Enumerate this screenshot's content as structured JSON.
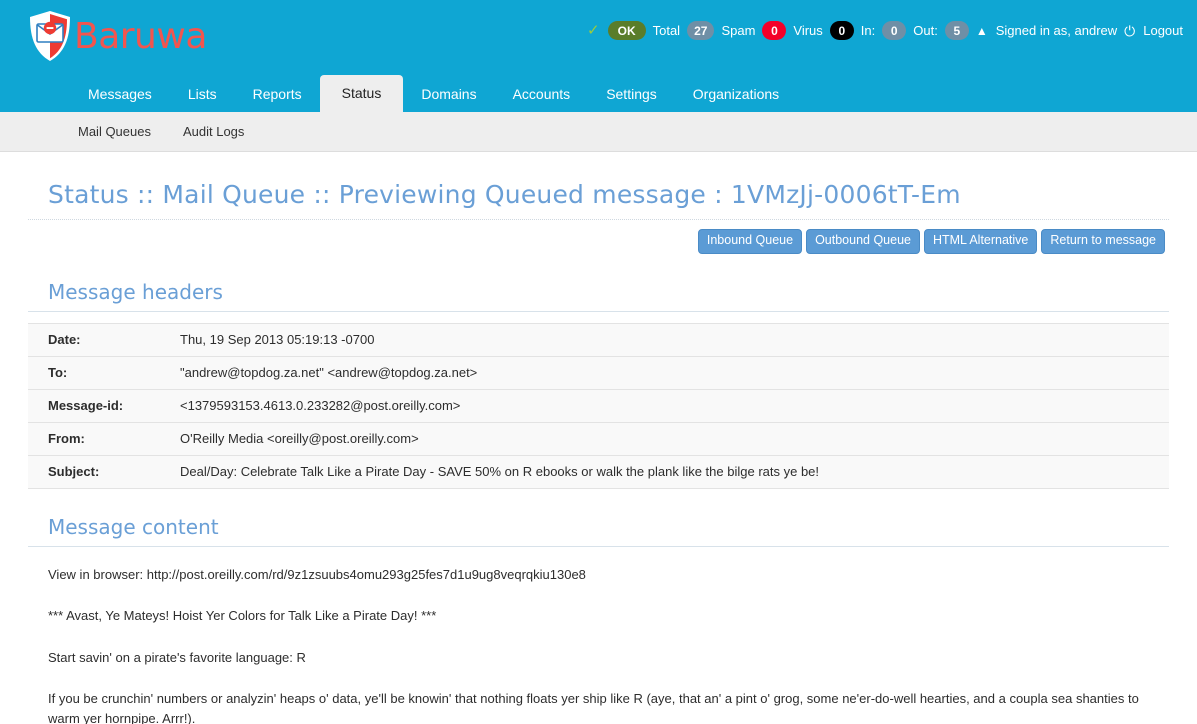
{
  "brand": {
    "name": "Baruwa",
    "logo_icon": "shield-envelope-logo",
    "color": "#f2554e",
    "header_bg": "#0fa6d3"
  },
  "statusbar": {
    "check_icon": "check-icon",
    "ok_label": "OK",
    "total_label": "Total",
    "total_value": "27",
    "spam_label": "Spam",
    "spam_value": "0",
    "virus_label": "Virus",
    "virus_value": "0",
    "in_label": "In:",
    "in_value": "0",
    "out_label": "Out:",
    "out_value": "5",
    "user_icon": "user-icon",
    "signed_in_text": "Signed in as, andrew",
    "power_icon": "power-icon",
    "logout_label": "Logout",
    "colors": {
      "ok": "#5a7d2a",
      "spam": "#f40029",
      "virus": "#000000",
      "neutral": "#6f8fa6",
      "check": "#9ccc3c"
    }
  },
  "mainnav": {
    "items": [
      {
        "label": "Messages",
        "active": false
      },
      {
        "label": "Lists",
        "active": false
      },
      {
        "label": "Reports",
        "active": false
      },
      {
        "label": "Status",
        "active": true
      },
      {
        "label": "Domains",
        "active": false
      },
      {
        "label": "Accounts",
        "active": false
      },
      {
        "label": "Settings",
        "active": false
      },
      {
        "label": "Organizations",
        "active": false
      }
    ]
  },
  "subnav": {
    "items": [
      {
        "label": "Mail Queues"
      },
      {
        "label": "Audit Logs"
      }
    ]
  },
  "page": {
    "title": "Status :: Mail Queue :: Previewing Queued message : 1VMzJj-0006tT-Em"
  },
  "buttons": [
    {
      "label": "Inbound Queue"
    },
    {
      "label": "Outbound Queue"
    },
    {
      "label": "HTML Alternative"
    },
    {
      "label": "Return to message"
    }
  ],
  "message_headers": {
    "section_title": "Message headers",
    "rows": [
      {
        "key": "Date:",
        "value": "Thu, 19 Sep 2013 05:19:13 -0700"
      },
      {
        "key": "To:",
        "value": "\"andrew@topdog.za.net\" <andrew@topdog.za.net>"
      },
      {
        "key": "Message-id:",
        "value": "<1379593153.4613.0.233282@post.oreilly.com>"
      },
      {
        "key": "From:",
        "value": "O'Reilly Media <oreilly@post.oreilly.com>"
      },
      {
        "key": "Subject:",
        "value": "Deal/Day: Celebrate Talk Like a Pirate Day - SAVE 50% on R ebooks or walk the plank like the bilge rats ye be!"
      }
    ]
  },
  "message_content": {
    "section_title": "Message content",
    "paragraphs": [
      "View in browser: http://post.oreilly.com/rd/9z1zsuubs4omu293g25fes7d1u9ug8veqrqkiu130e8",
      "*** Avast, Ye Mateys! Hoist Yer Colors for Talk Like a Pirate Day! ***",
      "Start savin' on a pirate's favorite language: R",
      "If you be crunchin' numbers or analyzin' heaps o' data, ye'll be knowin' that nothing floats yer ship like R (aye, that an' a pint o' grog, some ne'er-do-well hearties, and a coupla sea shanties to warm yer hornpipe. Arrr!)."
    ]
  }
}
